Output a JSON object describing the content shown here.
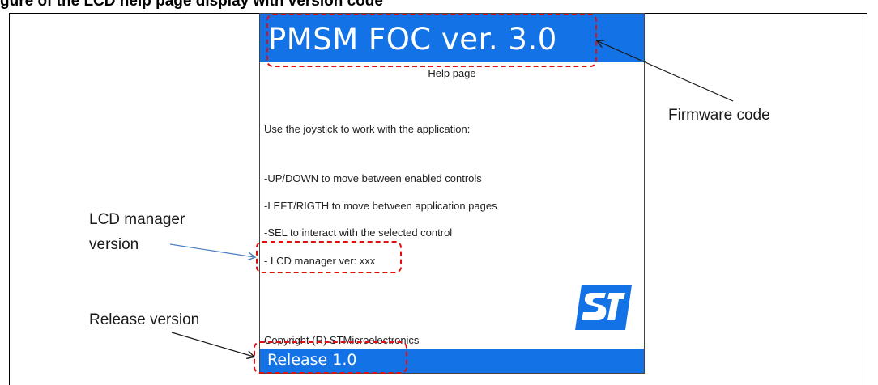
{
  "figure": {
    "top_caption": "gure                               of the LCD help page display with version code"
  },
  "lcd": {
    "title": "PMSM FOC ver. 3.0",
    "subtitle": "Help page",
    "intro": "Use the joystick to work with the application:",
    "lines": [
      "-UP/DOWN to move between enabled controls",
      "-LEFT/RIGTH to move between application pages",
      "-SEL to interact with the selected control",
      "- LCD manager ver: xxx"
    ],
    "copyright": "Copyright (R) STMicroelectronics",
    "footer": "Release 1.0",
    "logo_icon": "st-logo-icon",
    "colors": {
      "bar": "#1272e6",
      "highlight": "#e01010"
    }
  },
  "callouts": {
    "firmware": "Firmware code",
    "lcd_manager_line1": "LCD manager",
    "lcd_manager_line2": "version",
    "release": "Release version"
  }
}
